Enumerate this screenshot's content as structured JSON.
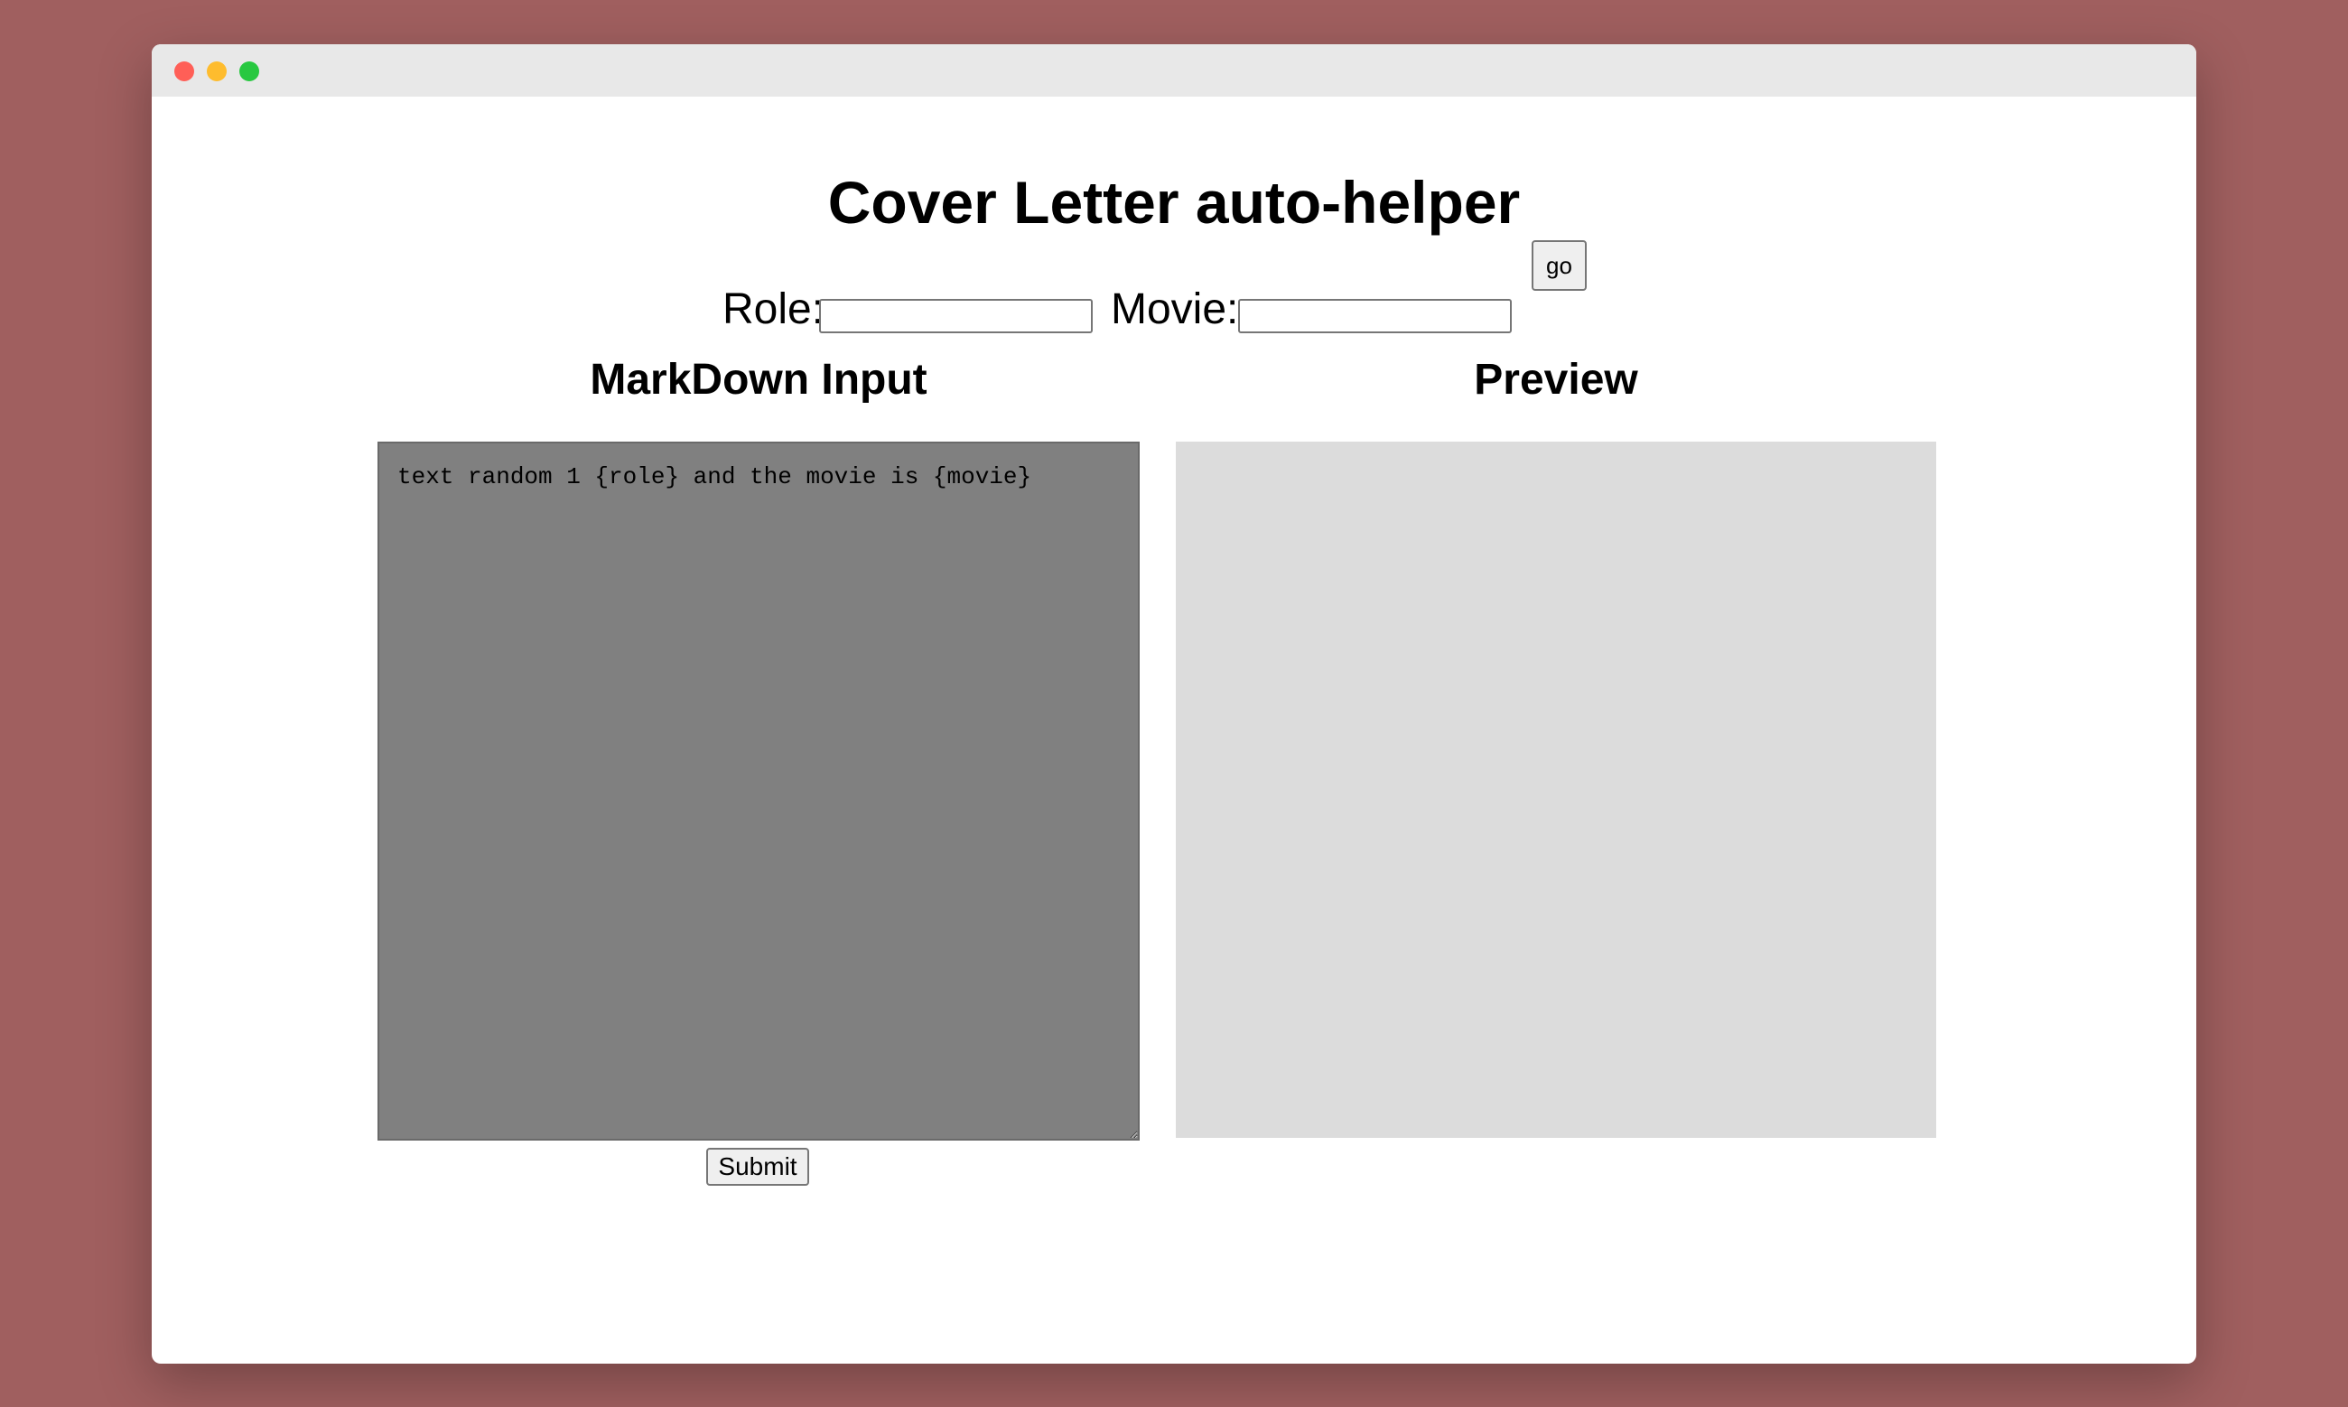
{
  "app": {
    "title": "Cover Letter auto-helper"
  },
  "window_controls": {
    "close_color": "#ff5f57",
    "minimize_color": "#febc2e",
    "maximize_color": "#28c840"
  },
  "form": {
    "role_label": "Role:",
    "role_value": "",
    "movie_label": "Movie:",
    "movie_value": "",
    "go_label": "go"
  },
  "editor": {
    "heading": "MarkDown Input",
    "content": "text random 1 {role} and the movie is {movie}",
    "submit_label": "Submit"
  },
  "preview": {
    "heading": "Preview",
    "content": ""
  },
  "colors": {
    "background": "#a05f5f",
    "editor_bg": "#808080",
    "preview_bg": "#dcdcdc"
  }
}
